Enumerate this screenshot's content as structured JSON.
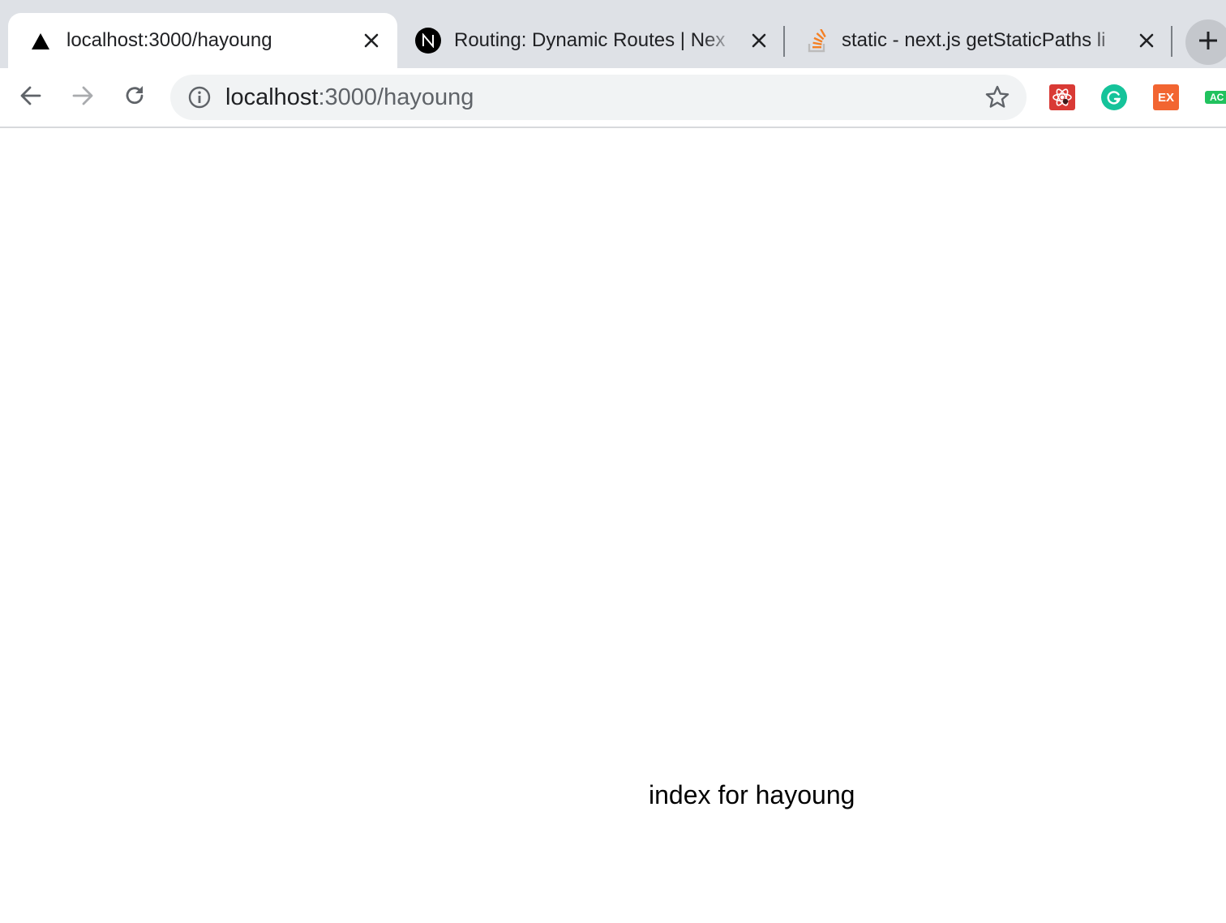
{
  "tabs": [
    {
      "title": "localhost:3000/hayoung",
      "icon": "triangle-favicon-icon",
      "active": true
    },
    {
      "title": "Routing: Dynamic Routes | Nex",
      "icon": "nextjs-favicon-icon",
      "active": false
    },
    {
      "title": "static - next.js getStaticPaths li",
      "icon": "stackoverflow-favicon-icon",
      "active": false
    }
  ],
  "omnibox": {
    "host": "localhost",
    "path": ":3000/hayoung"
  },
  "extensions": [
    {
      "name": "react-devtools-icon",
      "color": "#d93a35"
    },
    {
      "name": "grammarly-icon",
      "color": "#15c39a"
    },
    {
      "name": "ex-extension-icon",
      "label": "EX",
      "color": "#f26531"
    },
    {
      "name": "ac-extension-icon",
      "label": "AC",
      "color": "#21c25e"
    }
  ],
  "page": {
    "text": "index for hayoung"
  }
}
